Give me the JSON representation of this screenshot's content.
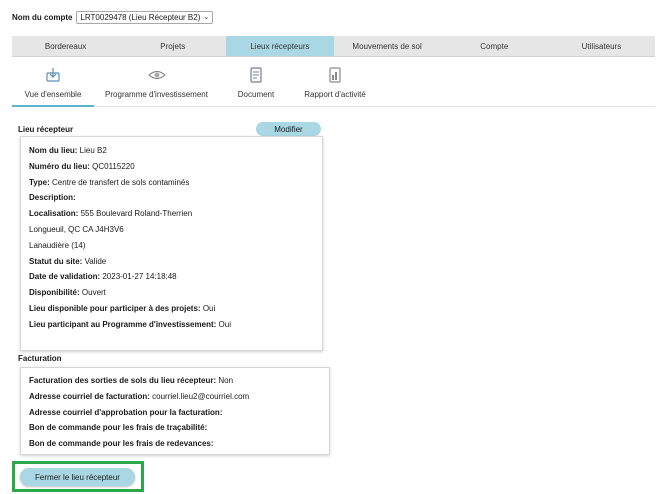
{
  "account": {
    "label": "Nom du compte",
    "selected": "LRT0029478 (Lieu Récepteur B2)"
  },
  "main_tabs": [
    {
      "label": "Bordereaux"
    },
    {
      "label": "Projets"
    },
    {
      "label": "Lieux récepteurs"
    },
    {
      "label": "Mouvements de sol"
    },
    {
      "label": "Compte"
    },
    {
      "label": "Utilisateurs"
    }
  ],
  "sub_tabs": [
    {
      "label": "Vue d'ensemble",
      "icon": "download-icon"
    },
    {
      "label": "Programme d'investissement",
      "icon": "eye-icon"
    },
    {
      "label": "Document",
      "icon": "document-icon"
    },
    {
      "label": "Rapport d'activité",
      "icon": "report-icon"
    }
  ],
  "lieu": {
    "title": "Lieu récepteur",
    "modify_label": "Modifier",
    "fields": [
      {
        "label": "Nom du lieu:",
        "value": " Lieu B2"
      },
      {
        "label": "Numéro du lieu:",
        "value": " QC0115220"
      },
      {
        "label": "Type:",
        "value": " Centre de transfert de sols contaminés"
      },
      {
        "label": "Description:",
        "value": ""
      },
      {
        "label": "Localisation:",
        "value": " 555 Boulevard Roland-Therrien"
      },
      {
        "label": "",
        "value": "Longueuil, QC CA J4H3V6"
      },
      {
        "label": "",
        "value": "Lanaudière (14)"
      },
      {
        "label": "Statut du site:",
        "value": " Valide"
      },
      {
        "label": "Date de validation:",
        "value": " 2023-01-27 14:18:48"
      },
      {
        "label": "Disponibilité:",
        "value": " Ouvert"
      },
      {
        "label": "Lieu disponible pour participer à des projets:",
        "value": " Oui"
      },
      {
        "label": "Lieu participant au Programme d'investissement:",
        "value": " Oui"
      }
    ]
  },
  "facturation": {
    "title": "Facturation",
    "fields": [
      {
        "label": "Facturation des sorties de sols du lieu récepteur:",
        "value": " Non"
      },
      {
        "label": "Adresse courriel de facturation:",
        "value": " courriel.lieu2@courriel.com"
      },
      {
        "label": "Adresse courriel d'approbation pour la facturation:",
        "value": ""
      },
      {
        "label": "Bon de commande pour les frais de traçabilité:",
        "value": ""
      },
      {
        "label": "Bon de commande pour les frais de redevances:",
        "value": ""
      }
    ]
  },
  "close_button": "Fermer le lieu récepteur",
  "colors": {
    "accent": "#a9d8e4",
    "highlight": "#2ba84a",
    "tab_bar": "#e6e6e6"
  }
}
